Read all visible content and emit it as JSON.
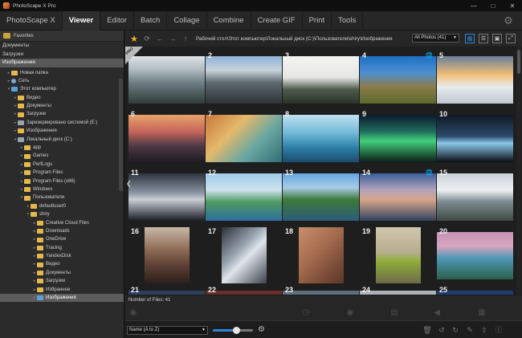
{
  "window": {
    "title": "PhotoScape X Pro"
  },
  "menu": {
    "tabs": [
      {
        "label": "PhotoScape X",
        "active": false
      },
      {
        "label": "Viewer",
        "active": true
      },
      {
        "label": "Editor",
        "active": false
      },
      {
        "label": "Batch",
        "active": false
      },
      {
        "label": "Collage",
        "active": false
      },
      {
        "label": "Combine",
        "active": false
      },
      {
        "label": "Create GIF",
        "active": false
      },
      {
        "label": "Print",
        "active": false
      },
      {
        "label": "Tools",
        "active": false
      }
    ]
  },
  "sidebar": {
    "favorites_label": "Favorites",
    "favorites": [
      {
        "label": "Документы",
        "selected": false
      },
      {
        "label": "Загрузки",
        "selected": false
      },
      {
        "label": "Изображения",
        "selected": true
      }
    ],
    "tree": [
      {
        "label": "Новая папка",
        "depth": 1,
        "icon": "yellow",
        "arrow": "▸",
        "selected": false
      },
      {
        "label": "Сеть",
        "depth": 1,
        "icon": "net",
        "arrow": "▸",
        "selected": false
      },
      {
        "label": "Этот компьютер",
        "depth": 1,
        "icon": "blue",
        "arrow": "▾",
        "selected": false
      },
      {
        "label": "Видео",
        "depth": 2,
        "icon": "yellow",
        "arrow": "▸",
        "selected": false
      },
      {
        "label": "Документы",
        "depth": 2,
        "icon": "yellow",
        "arrow": "▸",
        "selected": false
      },
      {
        "label": "Загрузки",
        "depth": 2,
        "icon": "yellow",
        "arrow": "▸",
        "selected": false
      },
      {
        "label": "Зарезервировано системой (E:)",
        "depth": 2,
        "icon": "drive",
        "arrow": "▸",
        "selected": false
      },
      {
        "label": "Изображения",
        "depth": 2,
        "icon": "yellow",
        "arrow": "▸",
        "selected": false
      },
      {
        "label": "Локальный диск (C:)",
        "depth": 2,
        "icon": "drive",
        "arrow": "▾",
        "selected": false
      },
      {
        "label": "app",
        "depth": 3,
        "icon": "yellow",
        "arrow": "▸",
        "selected": false
      },
      {
        "label": "Games",
        "depth": 3,
        "icon": "yellow",
        "arrow": "▸",
        "selected": false
      },
      {
        "label": "PerfLogs",
        "depth": 3,
        "icon": "yellow",
        "arrow": "▸",
        "selected": false
      },
      {
        "label": "Program Files",
        "depth": 3,
        "icon": "yellow",
        "arrow": "▸",
        "selected": false
      },
      {
        "label": "Program Files (x86)",
        "depth": 3,
        "icon": "yellow",
        "arrow": "▸",
        "selected": false
      },
      {
        "label": "Windows",
        "depth": 3,
        "icon": "yellow",
        "arrow": "▸",
        "selected": false
      },
      {
        "label": "Пользователи",
        "depth": 3,
        "icon": "yellow",
        "arrow": "▾",
        "selected": false
      },
      {
        "label": "defaultuser0",
        "depth": 4,
        "icon": "yellow",
        "arrow": "▸",
        "selected": false
      },
      {
        "label": "shiry",
        "depth": 4,
        "icon": "yellow",
        "arrow": "▾",
        "selected": false
      },
      {
        "label": "Creative Cloud Files",
        "depth": 5,
        "icon": "yellow",
        "arrow": "▸",
        "selected": false
      },
      {
        "label": "Downloads",
        "depth": 5,
        "icon": "yellow",
        "arrow": "▸",
        "selected": false
      },
      {
        "label": "OneDrive",
        "depth": 5,
        "icon": "yellow",
        "arrow": "▸",
        "selected": false
      },
      {
        "label": "Tracing",
        "depth": 5,
        "icon": "yellow",
        "arrow": "▸",
        "selected": false
      },
      {
        "label": "YandexDisk",
        "depth": 5,
        "icon": "yellow",
        "arrow": "▸",
        "selected": false
      },
      {
        "label": "Видео",
        "depth": 5,
        "icon": "yellow",
        "arrow": "▸",
        "selected": false
      },
      {
        "label": "Документы",
        "depth": 5,
        "icon": "yellow",
        "arrow": "▸",
        "selected": false
      },
      {
        "label": "Загрузки",
        "depth": 5,
        "icon": "yellow",
        "arrow": "▸",
        "selected": false
      },
      {
        "label": "Избранное",
        "depth": 5,
        "icon": "yellow",
        "arrow": "▸",
        "selected": false
      },
      {
        "label": "Изображения",
        "depth": 5,
        "icon": "blue",
        "arrow": "▸",
        "selected": true
      }
    ]
  },
  "pathbar": {
    "path": "Рабочий стол\\Этот компьютер\\Локальный диск (C:)\\Пользователи\\shiry\\Изображения",
    "filter_value": "All Photos (41)"
  },
  "badge": {
    "pro": "PRO"
  },
  "thumbnails": [
    {
      "num": "1",
      "globe": false,
      "portrait": false,
      "bg": "linear-gradient(180deg,#dfe3e6 0%,#aeb9bf 30%,#6f7f86 55%,#2f3c3a 100%)"
    },
    {
      "num": "2",
      "globe": false,
      "portrait": false,
      "bg": "linear-gradient(180deg,#8fb3d9 0%,#c8d2db 30%,#5f6b70 55%,#2d3336 100%)"
    },
    {
      "num": "3",
      "globe": false,
      "portrait": false,
      "bg": "linear-gradient(180deg,#f4f4f2 0%,#e6e7e4 45%,#4e5c4d 70%,#293327 100%)"
    },
    {
      "num": "4",
      "globe": true,
      "portrait": false,
      "bg": "linear-gradient(180deg,#1d6fc4 0%,#4d8fd0 35%,#8a7b48 65%,#5a6a2e 100%)"
    },
    {
      "num": "5",
      "globe": false,
      "portrait": false,
      "bg": "linear-gradient(180deg,#6b7f9a 0%,#f2c078 40%,#e7ecef 65%,#bfc8cf 100%)"
    },
    {
      "num": "6",
      "globe": false,
      "portrait": false,
      "bg": "linear-gradient(180deg,#e8a36a 0%,#c7655c 35%,#4f3a46 65%,#1f1b22 100%)"
    },
    {
      "num": "7",
      "globe": false,
      "portrait": false,
      "bg": "linear-gradient(135deg,#c8773a 0%,#e4b96b 35%,#6aa7a2 65%,#2f6e73 100%)"
    },
    {
      "num": "8",
      "globe": false,
      "portrait": false,
      "bg": "linear-gradient(180deg,#bfe2f0 0%,#6db7d6 40%,#2c7ea8 70%,#1c4c6c 100%)"
    },
    {
      "num": "9",
      "globe": false,
      "portrait": false,
      "bg": "linear-gradient(180deg,#0b1a2c 0%,#1f6b5c 35%,#41d07a 55%,#0e1d1a 100%)"
    },
    {
      "num": "10",
      "globe": false,
      "portrait": false,
      "bg": "linear-gradient(180deg,#111826 0%,#2a4a6a 45%,#8ac6e8 60%,#0b0f15 100%)"
    },
    {
      "num": "11",
      "globe": false,
      "portrait": false,
      "bg": "linear-gradient(180deg,#2d3540 0%,#8892a0 40%,#c9ced4 55%,#1a1e24 100%)"
    },
    {
      "num": "12",
      "globe": false,
      "portrait": false,
      "bg": "linear-gradient(180deg,#9ecbea 0%,#cfe3ef 35%,#4f9b60 60%,#2d6ea0 100%)"
    },
    {
      "num": "13",
      "globe": false,
      "portrait": false,
      "bg": "linear-gradient(180deg,#63a6e0 0%,#a9cde8 30%,#3d7a3a 55%,#2a5c7a 100%)"
    },
    {
      "num": "14",
      "globe": true,
      "portrait": false,
      "bg": "linear-gradient(180deg,#3a5f9a 0%,#b2a3b8 35%,#d9a48c 55%,#30445e 100%)"
    },
    {
      "num": "15",
      "globe": false,
      "portrait": false,
      "bg": "linear-gradient(180deg,#c9cfd6 0%,#eef1f3 35%,#7d8a8f 60%,#3e4a44 100%)"
    },
    {
      "num": "16",
      "globe": false,
      "portrait": true,
      "bg": "linear-gradient(180deg,#c8b8a6 0%,#8d6b55 40%,#5a3e33 70%,#2a1f1a 100%)"
    },
    {
      "num": "17",
      "globe": false,
      "portrait": true,
      "bg": "linear-gradient(135deg,#2a2f36 0%,#9aa6b2 40%,#dfe5ea 55%,#3a414a 100%)"
    },
    {
      "num": "18",
      "globe": false,
      "portrait": true,
      "bg": "linear-gradient(135deg,#c98f6c 0%,#a26a4d 45%,#7a4c37 75%,#5b3728 100%)"
    },
    {
      "num": "19",
      "globe": false,
      "portrait": true,
      "bg": "linear-gradient(180deg,#cfc6ad 0%,#b7ae8f 45%,#8fae3a 60%,#6c6a48 100%)"
    },
    {
      "num": "20",
      "globe": false,
      "portrait": false,
      "bg": "linear-gradient(180deg,#c792b6 0%,#d6a6c0 30%,#4f98b5 55%,#2a5f4a 100%)"
    },
    {
      "num": "21",
      "globe": false,
      "portrait": false,
      "bg": "linear-gradient(180deg,#2a3d5a 0%,#4a6a8a 100%)"
    },
    {
      "num": "22",
      "globe": false,
      "portrait": false,
      "bg": "linear-gradient(180deg,#6a2f2a 0%,#3a1c1a 100%)"
    },
    {
      "num": "23",
      "globe": false,
      "portrait": false,
      "bg": "linear-gradient(180deg,#5a6a7a 0%,#9aa6b2 100%)"
    },
    {
      "num": "24",
      "globe": false,
      "portrait": false,
      "bg": "linear-gradient(180deg,#b0b4b8 0%,#7c8288 100%)"
    },
    {
      "num": "25",
      "globe": false,
      "portrait": false,
      "bg": "linear-gradient(180deg,#1c3a6c 0%,#3a6aa8 100%)"
    }
  ],
  "status": {
    "file_count": "Number of Files: 41"
  },
  "bottom": {
    "sort_value": "Name (A to Z)",
    "zoom_fraction": 0.58
  },
  "colors": {
    "accent": "#2f86d6",
    "favorite_star": "#f0b429"
  },
  "icons": {
    "titlebar": [
      "minimize-icon",
      "maximize-icon",
      "close-icon"
    ],
    "pathbar": [
      "star-icon",
      "refresh-icon",
      "back-arrow-icon",
      "forward-arrow-icon",
      "up-arrow-icon"
    ],
    "views": [
      "grid-view-icon",
      "list-view-icon",
      "single-view-icon",
      "fullscreen-icon"
    ],
    "tools": [
      "camera-icon",
      "timer-icon",
      "disc-icon",
      "film-icon",
      "share-icon",
      "export-icon"
    ],
    "actions": [
      "trash-icon",
      "rotate-left-icon",
      "rotate-right-icon",
      "edit-icon",
      "upload-icon",
      "info-icon"
    ]
  }
}
